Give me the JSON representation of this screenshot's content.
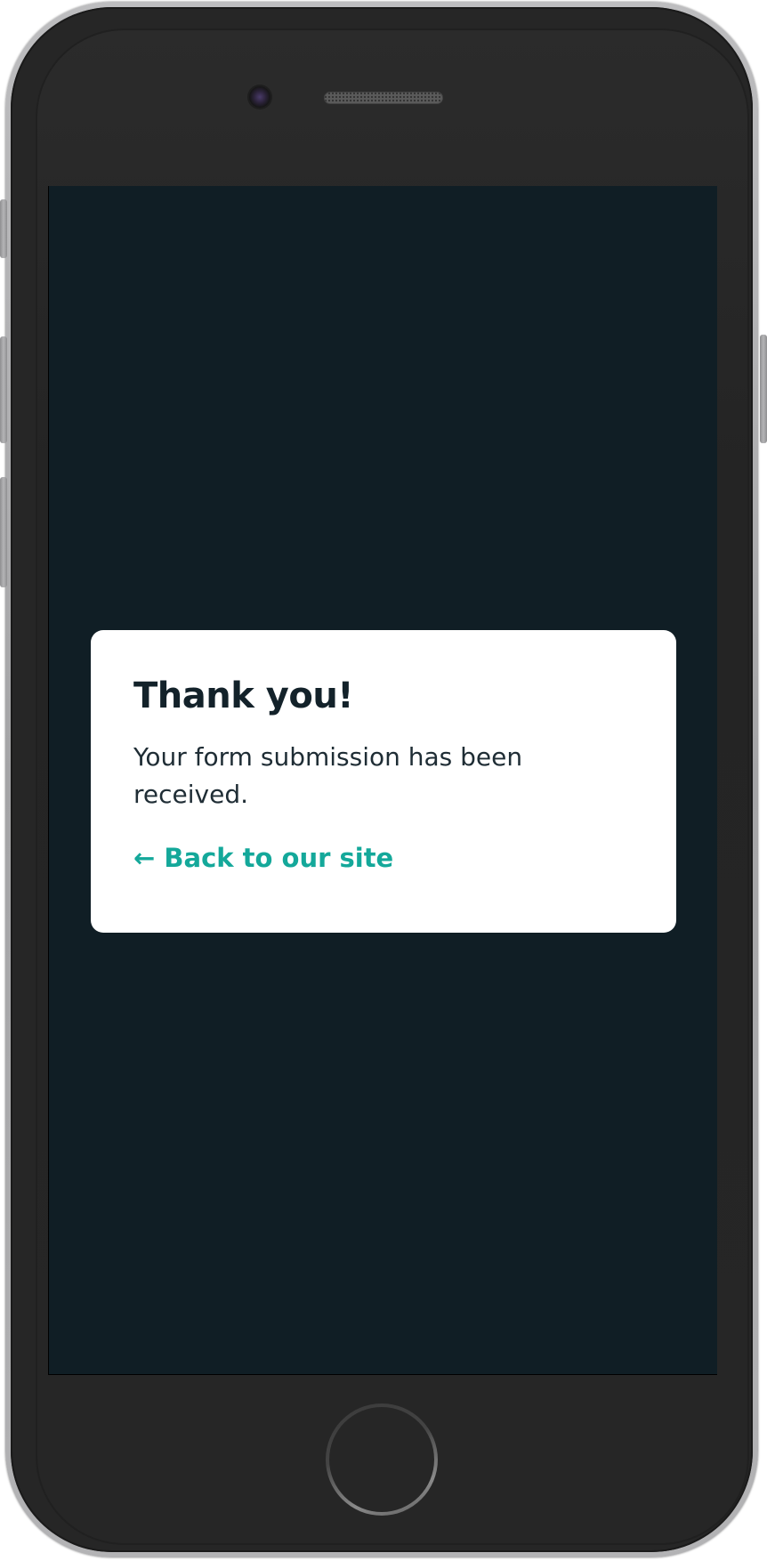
{
  "device": {
    "type": "smartphone",
    "body_color": "#262626",
    "rim_color": "#a8a8aa",
    "screen_background": "#101e25"
  },
  "confirmation": {
    "title": "Thank you!",
    "message": "Your form submission has been received.",
    "back_link_label": "← Back to our site"
  },
  "colors": {
    "card_background": "#ffffff",
    "title_text": "#13222a",
    "body_text": "#1f2d35",
    "link_accent": "#14a89a"
  },
  "icons": {
    "front_camera": "camera-icon",
    "speaker": "speaker-grille",
    "home": "home-button"
  }
}
